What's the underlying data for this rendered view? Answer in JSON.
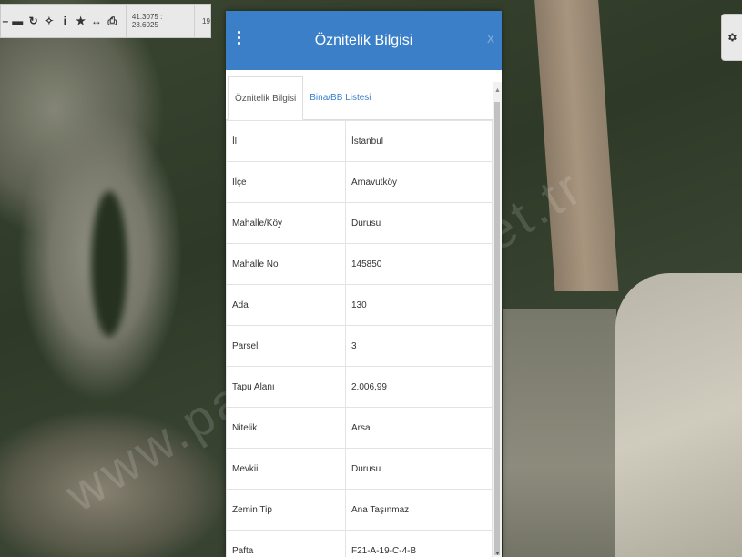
{
  "toolbar": {
    "coords": "41.3075 : 28.6025",
    "zoom": "19"
  },
  "watermark": "www.parselsorgu.net.tr",
  "panel": {
    "title": "Öznitelik Bilgisi",
    "close_label": "x",
    "tabs": [
      {
        "label": "Öznitelik Bilgisi",
        "active": true
      },
      {
        "label": "Bina/BB Listesi",
        "active": false
      }
    ],
    "rows": [
      {
        "key": "İl",
        "value": "İstanbul"
      },
      {
        "key": "İlçe",
        "value": "Arnavutköy"
      },
      {
        "key": "Mahalle/Köy",
        "value": "Durusu"
      },
      {
        "key": "Mahalle No",
        "value": "145850"
      },
      {
        "key": "Ada",
        "value": "130"
      },
      {
        "key": "Parsel",
        "value": "3"
      },
      {
        "key": "Tapu Alanı",
        "value": "2.006,99"
      },
      {
        "key": "Nitelik",
        "value": "Arsa"
      },
      {
        "key": "Mevkii",
        "value": "Durusu"
      },
      {
        "key": "Zemin Tip",
        "value": "Ana Taşınmaz"
      },
      {
        "key": "Pafta",
        "value": "F21-A-19-C-4-B"
      }
    ]
  }
}
